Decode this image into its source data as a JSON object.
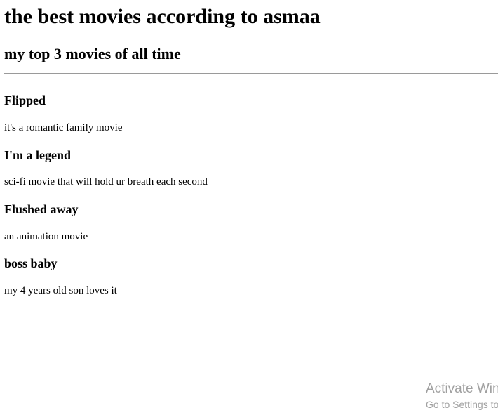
{
  "heading": "the best movies according to asmaa",
  "subheading": "my top 3 movies of all time",
  "movies": [
    {
      "title": "Flipped",
      "description": "it's a romantic family movie"
    },
    {
      "title": "I'm a legend",
      "description": "sci-fi movie that will hold ur breath each second"
    },
    {
      "title": "Flushed away",
      "description": "an animation movie"
    },
    {
      "title": "boss baby",
      "description": "my 4 years old son loves it"
    }
  ],
  "watermark": {
    "title": "Activate Windows",
    "subtitle": "Go to Settings to activate Windows."
  }
}
